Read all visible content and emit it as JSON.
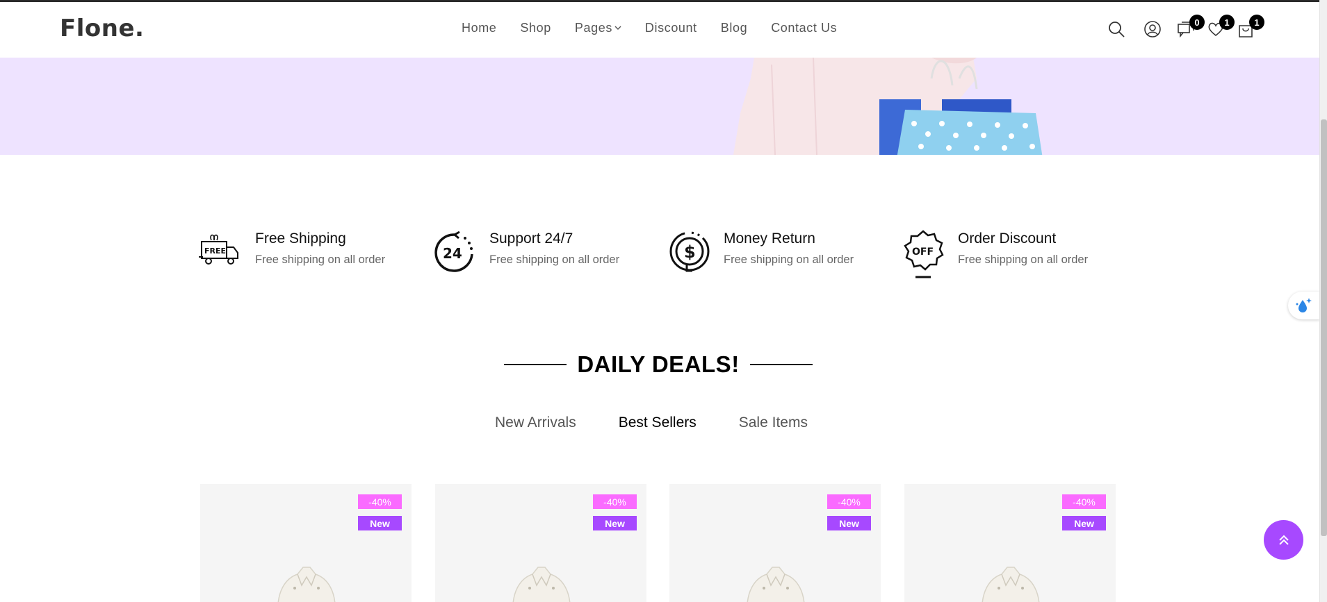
{
  "header": {
    "logo": "Flone.",
    "nav": [
      {
        "label": "Home"
      },
      {
        "label": "Shop"
      },
      {
        "label": "Pages",
        "has_dropdown": true
      },
      {
        "label": "Discount"
      },
      {
        "label": "Blog"
      },
      {
        "label": "Contact Us"
      }
    ],
    "icons": {
      "search": "search-icon",
      "account": "user-icon",
      "compare": {
        "icon": "compare-icon",
        "count": "0"
      },
      "wishlist": {
        "icon": "heart-icon",
        "count": "1"
      },
      "cart": {
        "icon": "cart-icon",
        "count": "1"
      }
    }
  },
  "features": [
    {
      "icon": "free-shipping-truck-icon",
      "title": "Free Shipping",
      "desc": "Free shipping on all order"
    },
    {
      "icon": "support-24-7-icon",
      "title": "Support 24/7",
      "desc": "Free shipping on all order"
    },
    {
      "icon": "money-return-icon",
      "title": "Money Return",
      "desc": "Free shipping on all order"
    },
    {
      "icon": "order-discount-icon",
      "title": "Order Discount",
      "desc": "Free shipping on all order"
    }
  ],
  "section": {
    "title": "DAILY DEALS!",
    "tabs": [
      {
        "label": "New Arrivals",
        "active": false
      },
      {
        "label": "Best Sellers",
        "active": true
      },
      {
        "label": "Sale Items",
        "active": false
      }
    ]
  },
  "products": [
    {
      "discount": "-40%",
      "badge": "New"
    },
    {
      "discount": "-40%",
      "badge": "New"
    },
    {
      "discount": "-40%",
      "badge": "New"
    },
    {
      "discount": "-40%",
      "badge": "New"
    }
  ],
  "colors": {
    "accent": "#a749ff",
    "discount_tag": "#fa6bff",
    "hero_bg": "#eee3ff"
  }
}
